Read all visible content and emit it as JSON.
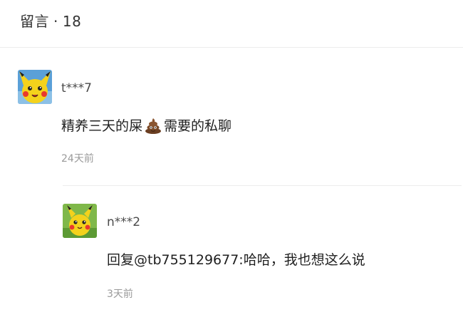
{
  "header": {
    "label": "留言",
    "separator": "·",
    "count": "18"
  },
  "comments": [
    {
      "username": "t***7",
      "text_before": "精养三天的屎",
      "icon": "poop-emoji-icon",
      "text_after": "需要的私聊",
      "time": "24天前"
    },
    {
      "username": "n***2",
      "text": "回复@tb755129677:哈哈，我也想这么说",
      "time": "3天前"
    }
  ],
  "colors": {
    "divider": "#ececec",
    "timestamp": "#9a9a9a",
    "avatar_bg": "#f4d21c"
  }
}
